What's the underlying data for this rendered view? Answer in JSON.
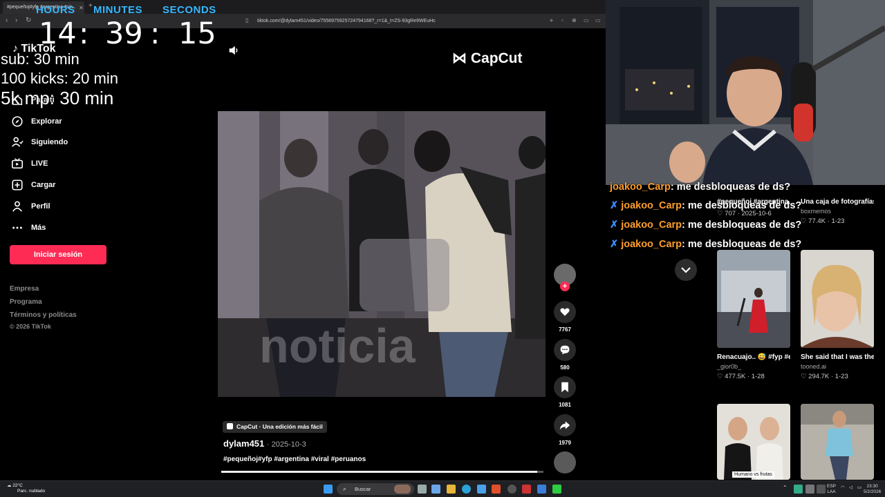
{
  "browser": {
    "tab_title": "#pequeñoj#yfp #argentina #vir...",
    "url": "tiktok.com/@dylam451/video/7556975925724794168?_r=1&_t=ZS-93gRe9WEuHc"
  },
  "overlay": {
    "hours_label": "HOURS",
    "minutes_label": "MINUTES",
    "seconds_label": "SECONDS",
    "hours": "14",
    "colon1": ":",
    "minutes": "39",
    "colon2": ":",
    "seconds": "15",
    "goals": [
      "sub: 30 min",
      "100 kicks: 20 min",
      "5k mp: 30 min"
    ]
  },
  "sidebar": {
    "logo": "TikTok",
    "items": [
      {
        "label": "Para ti",
        "icon": "home-icon"
      },
      {
        "label": "Explorar",
        "icon": "compass-icon"
      },
      {
        "label": "Siguiendo",
        "icon": "following-icon"
      },
      {
        "label": "LIVE",
        "icon": "live-icon"
      },
      {
        "label": "Cargar",
        "icon": "upload-icon"
      },
      {
        "label": "Perfil",
        "icon": "profile-icon"
      },
      {
        "label": "Más",
        "icon": "more-icon"
      }
    ],
    "login": "Iniciar sesión",
    "footer": [
      "Empresa",
      "Programa",
      "Términos y políticas",
      "© 2026 TikTok"
    ]
  },
  "video": {
    "watermark": "CapCut",
    "caption_watermark": "noticia",
    "likes": "7767",
    "comments": "580",
    "saves": "1081",
    "shares": "1979",
    "capcut_tag": "CapCut · Una edición más fácil",
    "author": "dylam451",
    "date": "· 2025-10-3",
    "hashtags": "#pequeñoj#yfp #argentina #viral #peruanos",
    "progress": 0.98
  },
  "chat": [
    {
      "user": "joakoo_Carp",
      "msg": ": me desbloqueas de ds?"
    },
    {
      "user": "joakoo_Carp",
      "msg": ": me desbloqueas de ds?"
    },
    {
      "user": "joakoo_Carp",
      "msg": ": me desbloqueas de ds?"
    },
    {
      "user": "joakoo_Carp",
      "msg": ": me desbloqueas de ds?"
    }
  ],
  "grid": [
    {
      "title": "#pequeñoj #argentina...",
      "user": "",
      "likes": "707",
      "date": "2025-10-6"
    },
    {
      "title": "Una caja de fotografías...",
      "user": "boxmemos",
      "likes": "77.4K",
      "date": "1-23"
    },
    {
      "title": "Renacuajo.. 😅 #fyp #ensayo...",
      "user": "_gior0b_",
      "likes": "477.5K",
      "date": "1-28"
    },
    {
      "title": "She said that I was the best Spanish...",
      "user": "tooned.ai",
      "likes": "294.7K",
      "date": "1-23"
    },
    {
      "title": "Humano vs frutas",
      "user": "",
      "likes": "",
      "date": ""
    },
    {
      "title": "",
      "user": "",
      "likes": "",
      "date": ""
    }
  ],
  "taskbar": {
    "temp": "22°C",
    "weather": "Parc. nublado",
    "search": "Buscar",
    "lang1": "ESP",
    "lang2": "LAA",
    "time": "23:30",
    "date": "5/2/2026"
  },
  "colors": {
    "tiktok_red": "#fe2c55",
    "timer_blue": "#35b7ff",
    "chat_user": "#ff9e2c"
  }
}
